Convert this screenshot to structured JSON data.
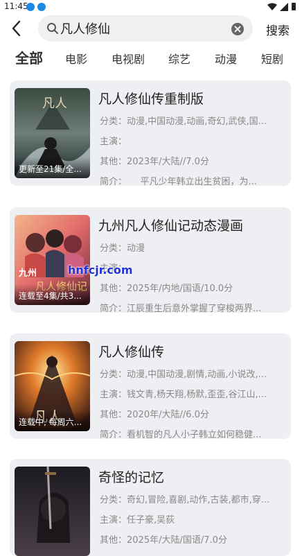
{
  "status": {
    "time": "11:45"
  },
  "search": {
    "query": "凡人修仙",
    "button": "搜索"
  },
  "tabs": [
    "全部",
    "电影",
    "电视剧",
    "综艺",
    "动漫",
    "短剧"
  ],
  "labels": {
    "category": "分类：",
    "cast": "主演：",
    "other": "其他：",
    "intro": "简介："
  },
  "results": [
    {
      "title": "凡人修仙传重制版",
      "badge": "更新至21集/全...",
      "category": "动漫,中国动漫,动画,奇幻,武侠,国...",
      "cast": "",
      "other": "2023年/大陆//7.0分",
      "intro": "　　平凡少年韩立出生贫困，为..."
    },
    {
      "title": "九州凡人修仙记动态漫画",
      "badge": "连载至4集/共3...",
      "category": "动漫",
      "cast": "",
      "other": "2025年/内地/国语/10.0分",
      "intro": "江辰重生后意外掌握了穿梭两界..."
    },
    {
      "title": "凡人修仙传",
      "badge": "连载中, 每周六...",
      "category": "动漫,中国动漫,剧情,动画,小说改,...",
      "cast": "钱文青,杨天翔,杨默,歪歪,谷江山,...",
      "other": "2020年/大陆//6.0分",
      "intro": "看机智的凡人小子韩立如何稳健..."
    },
    {
      "title": "奇怪的记忆",
      "badge": "",
      "category": "奇幻,冒险,喜剧,动作,古装,都市,穿...",
      "cast": "任子豪,吴荻",
      "other": "2025年/大陆/国语/7.0分",
      "intro": ""
    }
  ],
  "watermark": "hnfcjr.com",
  "colors": {
    "card_bg": "#eeeff2",
    "search_bg": "#f0f0f0",
    "status_blue": "#1e88e5"
  }
}
